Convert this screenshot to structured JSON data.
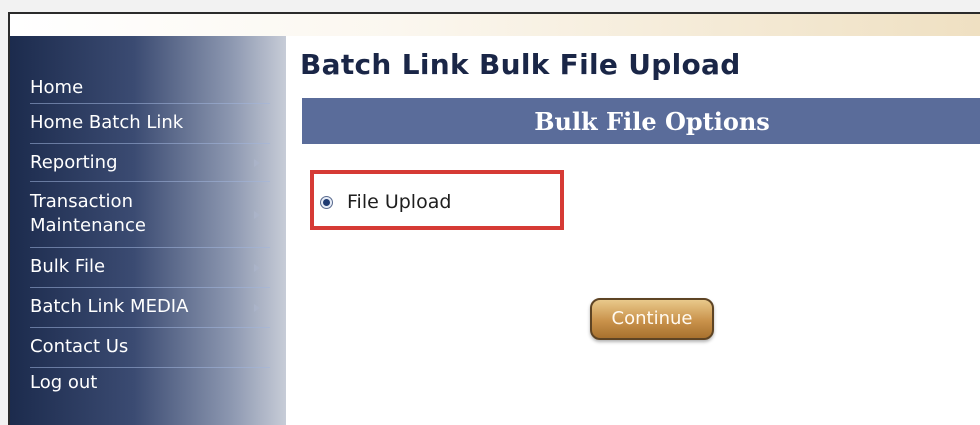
{
  "nav": {
    "items": [
      {
        "label": "Home",
        "has_submenu": false
      },
      {
        "label": "Home Batch Link",
        "has_submenu": false
      },
      {
        "label": "Reporting",
        "has_submenu": true
      },
      {
        "label": "Transaction Maintenance",
        "has_submenu": true
      },
      {
        "label": "Bulk File",
        "has_submenu": true
      },
      {
        "label": "Batch Link MEDIA",
        "has_submenu": true
      },
      {
        "label": "Contact Us",
        "has_submenu": false
      },
      {
        "label": "Log out",
        "has_submenu": false
      }
    ]
  },
  "main": {
    "title": "Batch Link Bulk File Upload",
    "section_header": "Bulk File Options",
    "options": [
      {
        "label": "File Upload",
        "selected": true
      }
    ],
    "continue_label": "Continue"
  },
  "colors": {
    "sidebar_dark": "#1c2b4d",
    "section_bar": "#5a6c9a",
    "title": "#1a2647",
    "highlight": "#d63a35",
    "button": "#c9924b"
  }
}
